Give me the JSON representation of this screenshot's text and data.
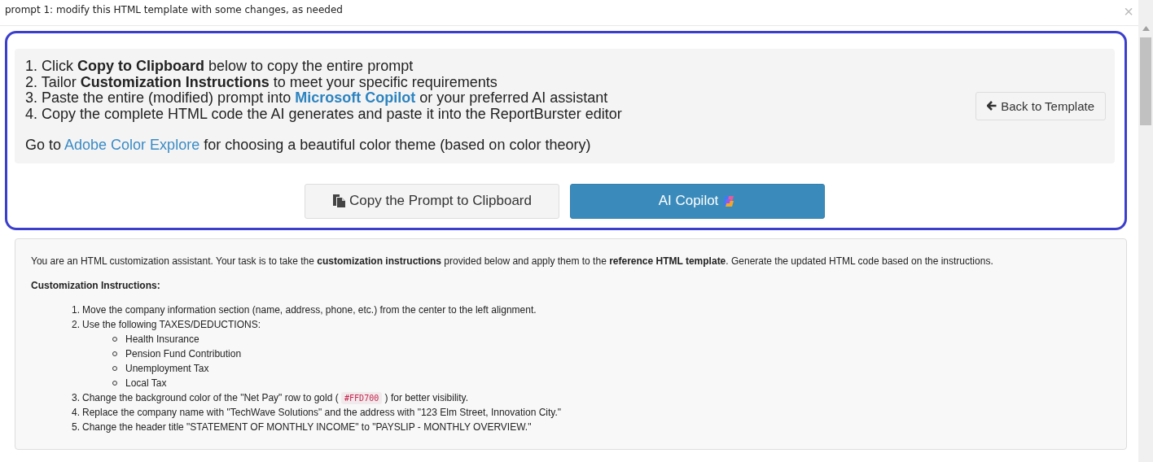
{
  "dialog": {
    "title": "prompt 1: modify this HTML template with some changes, as needed",
    "close": "×"
  },
  "guide": {
    "steps": [
      {
        "text": "1. Click **Copy to Clipboard** below to copy the entire prompt"
      },
      {
        "text": "2. Tailor **Customization Instructions** to meet your specific requirements"
      },
      {
        "text": "3. Paste the entire (modified) prompt into ",
        "link": "Microsoft Copilot",
        "after": " or your preferred AI assistant"
      },
      {
        "text": "4. Copy the complete HTML code the AI generates and paste it into the ReportBurster editor"
      }
    ],
    "tip": {
      "text": "Go to ",
      "link": "Adobe Color Explore",
      "after": " for choosing a beautiful color theme (based on color theory)"
    },
    "back_button": "Back to Template"
  },
  "actions": [
    {
      "kind": "secondary",
      "label": "Copy the Prompt to Clipboard"
    },
    {
      "kind": "primary",
      "label": "AI Copilot"
    }
  ],
  "prompt": {
    "intro": "You are an HTML customization assistant. Your task is to take the **customization instructions** provided below and apply them to the **reference HTML template**. Generate the updated HTML code based on the instructions.",
    "heading": "Customization Instructions:",
    "items": [
      {
        "number": "1.",
        "text": "Move the company information section (name, address, phone, etc.) from the center to the left alignment."
      },
      {
        "number": "2.",
        "text": "Use the following TAXES/DEDUCTIONS:",
        "children": [
          {
            "text": "Health Insurance"
          },
          {
            "text": "Pension Fund Contribution"
          },
          {
            "text": "Unemployment Tax"
          },
          {
            "text": "Local Tax"
          }
        ]
      },
      {
        "number": "3.",
        "text": "Change the background color of the \"Net Pay\" row to gold ( ",
        "code": "#FFD700",
        "after": " ) for better visibility."
      },
      {
        "number": "4.",
        "text": "Replace the company name with \"TechWave Solutions\" and the address with \"123 Elm Street, Innovation City.\""
      },
      {
        "number": "5.",
        "text": "Change the header title \"STATEMENT OF MONTHLY INCOME\" to \"PAYSLIP - MONTHLY OVERVIEW.\""
      }
    ]
  }
}
